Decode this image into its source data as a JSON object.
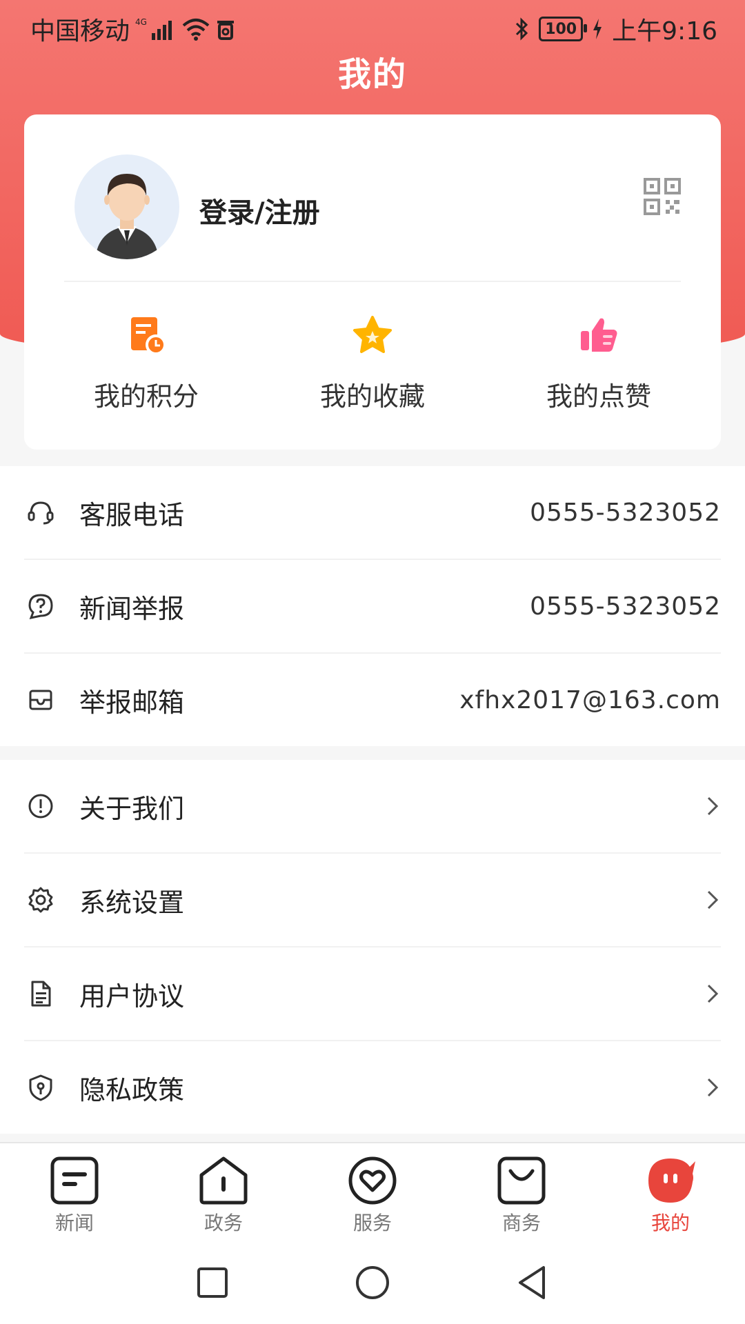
{
  "status_bar": {
    "carrier": "中国移动",
    "network": "4G",
    "battery": "100",
    "time": "上午9:16"
  },
  "header": {
    "title": "我的"
  },
  "profile": {
    "login_label": "登录/注册"
  },
  "quick_actions": [
    {
      "label": "我的积分",
      "icon": "points-icon"
    },
    {
      "label": "我的收藏",
      "icon": "star-icon"
    },
    {
      "label": "我的点赞",
      "icon": "thumbs-up-icon"
    }
  ],
  "contact": [
    {
      "label": "客服电话",
      "value": "0555-5323052",
      "icon": "headset-icon"
    },
    {
      "label": "新闻举报",
      "value": "0555-5323052",
      "icon": "question-bubble-icon"
    },
    {
      "label": "举报邮箱",
      "value": "xfhx2017@163.com",
      "icon": "mail-icon"
    }
  ],
  "menu": [
    {
      "label": "关于我们",
      "icon": "info-icon"
    },
    {
      "label": "系统设置",
      "icon": "gear-icon"
    },
    {
      "label": "用户协议",
      "icon": "document-icon"
    },
    {
      "label": "隐私政策",
      "icon": "shield-icon"
    }
  ],
  "tabs": [
    {
      "label": "新闻",
      "icon": "news-icon"
    },
    {
      "label": "政务",
      "icon": "government-icon"
    },
    {
      "label": "服务",
      "icon": "heart-service-icon"
    },
    {
      "label": "商务",
      "icon": "shopping-bag-icon"
    },
    {
      "label": "我的",
      "icon": "mine-icon",
      "active": true
    }
  ],
  "colors": {
    "brand": "#f05a53",
    "active_tab": "#e8453c",
    "points": "#ff7a1a",
    "star": "#ffb400",
    "like": "#ff5d8f"
  }
}
